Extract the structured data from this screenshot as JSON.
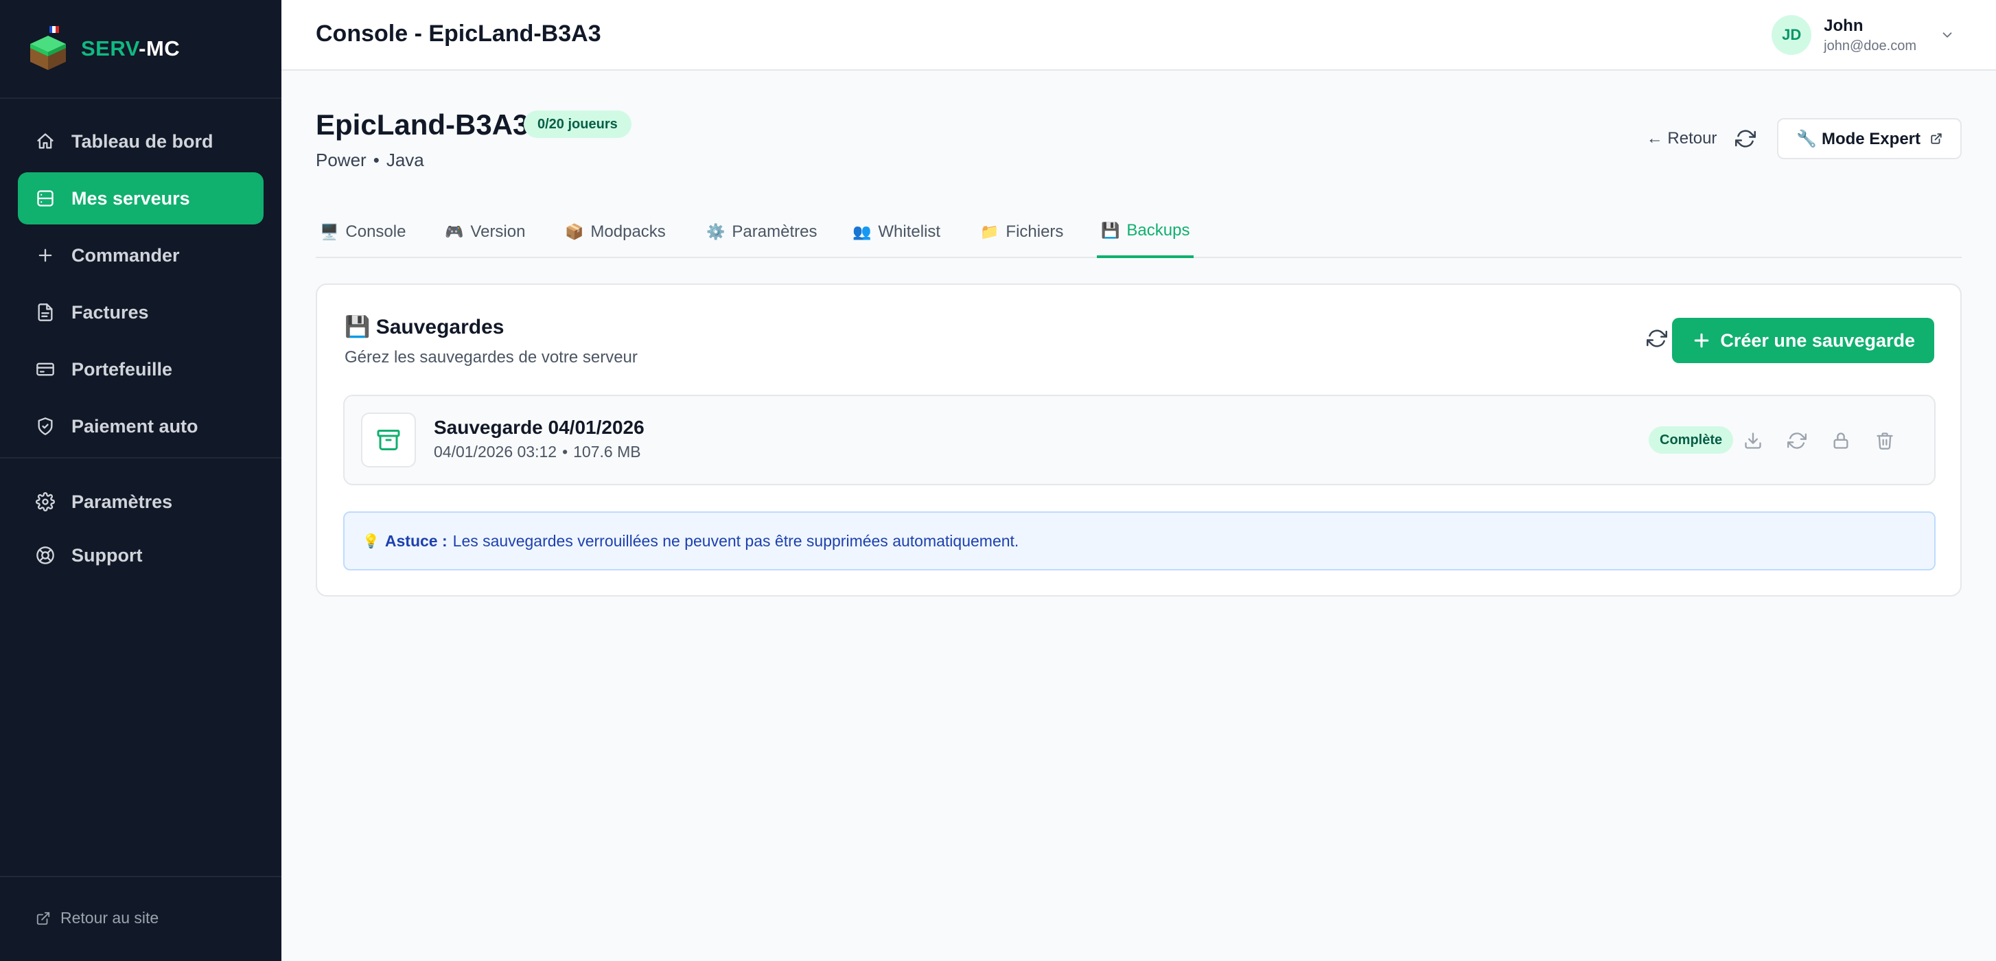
{
  "brand": {
    "part1": "SERV",
    "part2": "-MC",
    "logo_icon": "grass-block-icon"
  },
  "nav": {
    "items": [
      {
        "label": "Tableau de bord",
        "icon": "home-icon"
      },
      {
        "label": "Mes serveurs",
        "icon": "server-icon",
        "active": true
      },
      {
        "label": "Commander",
        "icon": "plus-icon"
      },
      {
        "label": "Factures",
        "icon": "file-icon"
      },
      {
        "label": "Portefeuille",
        "icon": "wallet-icon"
      },
      {
        "label": "Paiement auto",
        "icon": "shield-icon"
      }
    ],
    "bottom_items": [
      {
        "label": "Paramètres",
        "icon": "gear-icon"
      },
      {
        "label": "Support",
        "icon": "lifebuoy-icon"
      }
    ],
    "back_site": "Retour au site"
  },
  "header": {
    "title": "Console - EpicLand-B3A3",
    "user": {
      "initials": "JD",
      "name": "John",
      "email": "john@doe.com"
    }
  },
  "server": {
    "name": "EpicLand-B3A3",
    "players_badge": "0/20 joueurs",
    "plan": "Power",
    "separator": "•",
    "edition": "Java",
    "back_label": "← Retour",
    "expert_label": "🔧 Mode Expert"
  },
  "tabs": [
    {
      "emoji": "🖥️",
      "label": "Console"
    },
    {
      "emoji": "🎮",
      "label": "Version"
    },
    {
      "emoji": "📦",
      "label": "Modpacks"
    },
    {
      "emoji": "⚙️",
      "label": "Paramètres"
    },
    {
      "emoji": "👥",
      "label": "Whitelist"
    },
    {
      "emoji": "📁",
      "label": "Fichiers"
    },
    {
      "emoji": "💾",
      "label": "Backups",
      "active": true
    }
  ],
  "backups": {
    "title": "💾 Sauvegardes",
    "subtitle": "Gérez les sauvegardes de votre serveur",
    "create_label": "Créer une sauvegarde",
    "items": [
      {
        "name": "Sauvegarde 04/01/2026",
        "datetime": "04/01/2026 03:12",
        "size": "107.6 MB",
        "status": "Complète"
      }
    ],
    "tip": {
      "emoji": "💡",
      "label": "Astuce :",
      "text": "Les sauvegardes verrouillées ne peuvent pas être supprimées automatiquement."
    }
  },
  "colors": {
    "accent": "#10b06f",
    "sidebar_bg": "#111827",
    "badge_bg": "#d1fae5",
    "tip_bg": "#eff6ff"
  }
}
